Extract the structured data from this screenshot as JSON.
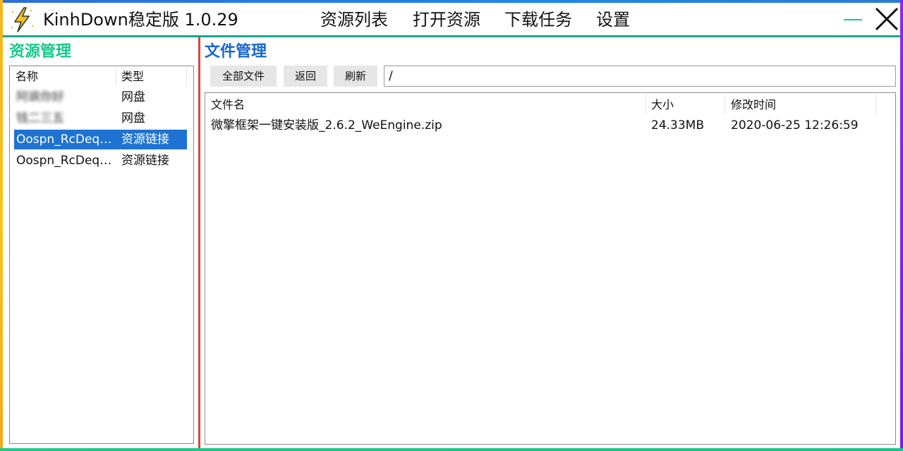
{
  "app": {
    "title": "KinhDown稳定版 1.0.29"
  },
  "nav": {
    "items": [
      {
        "label": "资源列表",
        "active": true
      },
      {
        "label": "打开资源",
        "active": false
      },
      {
        "label": "下载任务",
        "active": false
      },
      {
        "label": "设置",
        "active": false
      }
    ]
  },
  "window_controls": {
    "minimize_icon": "minimize-icon",
    "close_icon": "close-icon"
  },
  "resource_panel": {
    "title": "资源管理",
    "columns": [
      "名称",
      "类型"
    ],
    "rows": [
      {
        "name": "阿飒你好",
        "type": "网盘",
        "selected": false,
        "obscured": true
      },
      {
        "name": "钱二三五",
        "type": "网盘",
        "selected": false,
        "obscured": true
      },
      {
        "name": "Oospn_RcDeqx...",
        "type": "资源链接",
        "selected": true,
        "obscured": false
      },
      {
        "name": "Oospn_RcDeqx...",
        "type": "资源链接",
        "selected": false,
        "obscured": false
      }
    ]
  },
  "file_panel": {
    "title": "文件管理",
    "toolbar": {
      "all_files_label": "全部文件",
      "back_label": "返回",
      "refresh_label": "刷新"
    },
    "path": "/",
    "columns": [
      "文件名",
      "大小",
      "修改时间"
    ],
    "files": [
      {
        "name": "微擎框架一键安装版_2.6.2_WeEngine.zip",
        "size": "24.33MB",
        "modified": "2020-06-25 12:26:59"
      }
    ]
  },
  "colors": {
    "accent_blue": "#1e9ae0",
    "resource_title_green": "#17c98a",
    "file_title_blue": "#1767cf",
    "selection_blue": "#1e73d2",
    "divider_red": "#d9463e",
    "separator_teal": "#1aa589",
    "minimize_green": "#18c98a"
  }
}
